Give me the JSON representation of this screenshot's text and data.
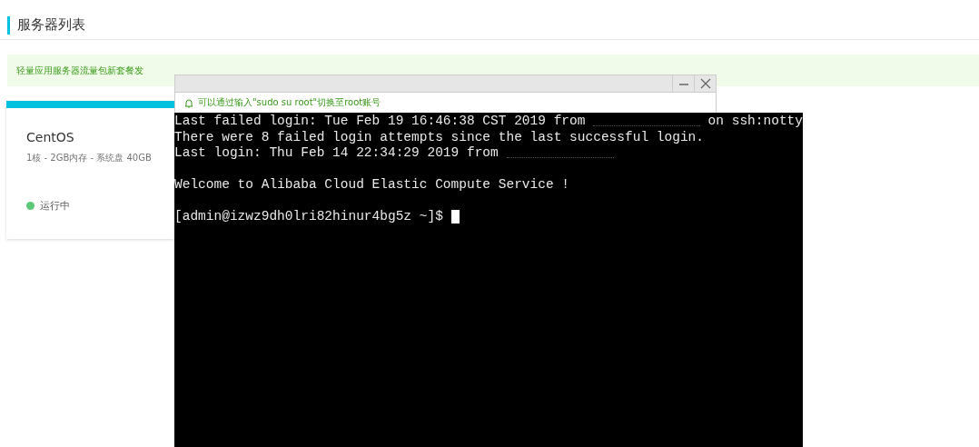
{
  "page": {
    "title": "服务器列表"
  },
  "banner": {
    "text": "轻量应用服务器流量包新套餐发"
  },
  "server_card": {
    "name": "CentOS",
    "specs": "1核 - 2GB内存 - 系统盘 40GB",
    "status": "运行中"
  },
  "terminal": {
    "notice": "可以通过输入\"sudo su root\"切换至root账号",
    "lines": [
      {
        "kind": "text",
        "segments": [
          {
            "kind": "text",
            "text": "Last failed login: Tue Feb 19 16:46:38 CST 2019 from"
          },
          {
            "kind": "redacted"
          },
          {
            "kind": "text",
            "text": "on ssh:notty"
          }
        ]
      },
      {
        "kind": "text",
        "segments": [
          {
            "kind": "text",
            "text": "There were 8 failed login attempts since the last successful login."
          }
        ]
      },
      {
        "kind": "text",
        "segments": [
          {
            "kind": "text",
            "text": "Last login: Thu Feb 14 22:34:29 2019 from"
          },
          {
            "kind": "redacted"
          }
        ]
      },
      {
        "kind": "blank"
      },
      {
        "kind": "text",
        "segments": [
          {
            "kind": "text",
            "text": "Welcome to Alibaba Cloud Elastic Compute Service !"
          }
        ]
      },
      {
        "kind": "blank"
      },
      {
        "kind": "text",
        "cursor": true,
        "segments": [
          {
            "kind": "text",
            "text": "[admin@izwz9dh0lri82hinur4bg5z ~]$"
          }
        ]
      }
    ]
  }
}
